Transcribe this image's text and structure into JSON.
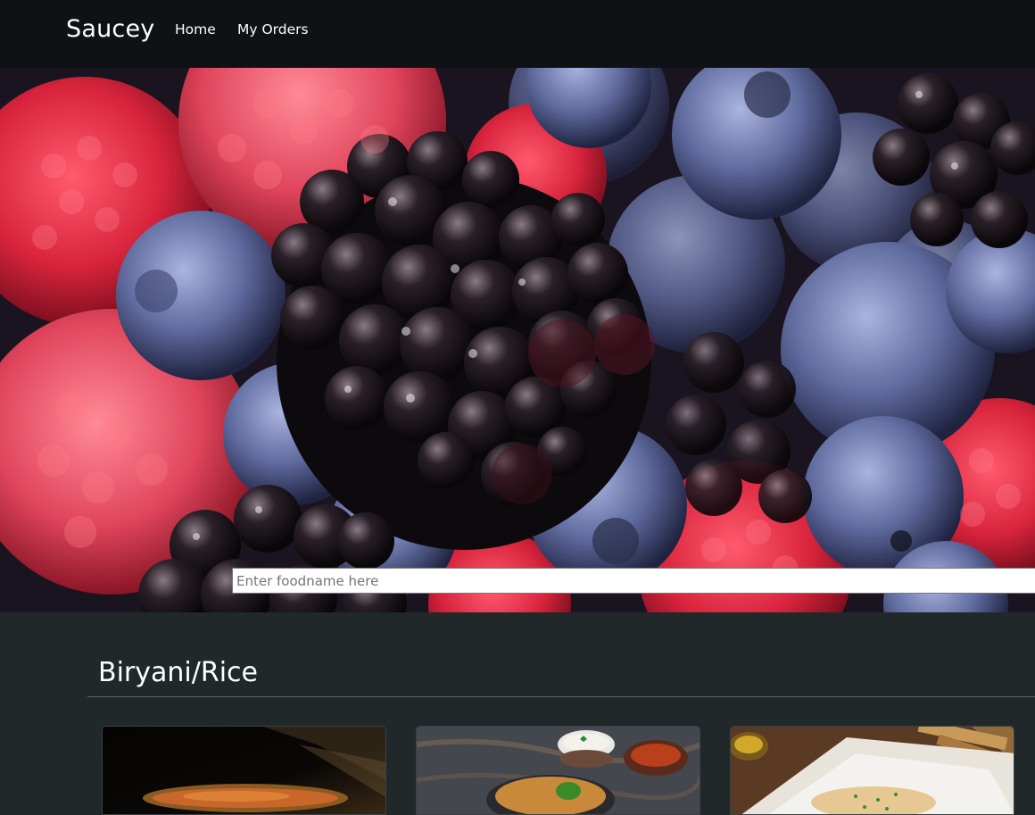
{
  "navbar": {
    "brand": "Saucey",
    "links": [
      {
        "label": "Home"
      },
      {
        "label": "My Orders"
      }
    ]
  },
  "hero": {
    "image": "mixed-berries-photo",
    "search": {
      "placeholder": "Enter foodname here",
      "value": ""
    }
  },
  "section": {
    "title": "Biryani/Rice",
    "cards": [
      {
        "image": "biryani-pot-photo"
      },
      {
        "image": "biryani-plate-with-raita-photo"
      },
      {
        "image": "rice-plate-photo"
      }
    ]
  },
  "colors": {
    "navbar_bg": "#0e1214",
    "page_bg": "#212829",
    "text": "#ffffff"
  }
}
